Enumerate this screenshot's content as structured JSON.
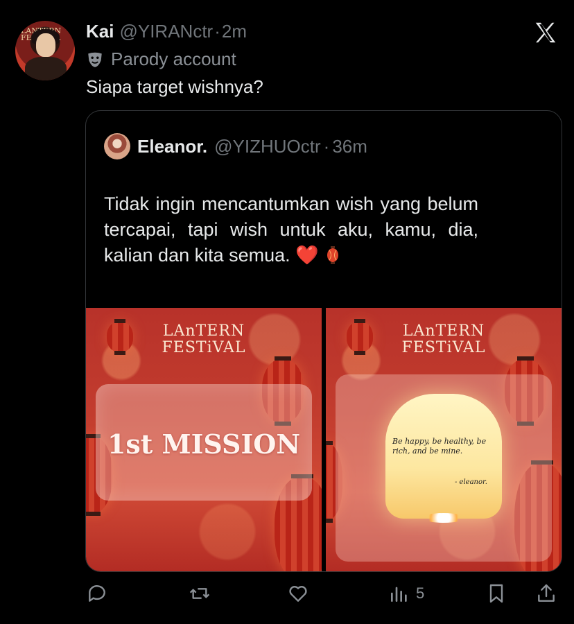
{
  "tweet": {
    "author_name": "Kai",
    "author_handle": "@YIRANctr",
    "separator": "·",
    "time": "2m",
    "badge_text": "Parody account",
    "text": "Siapa target wishnya?"
  },
  "avatar_text": "LANTERN\nFESTIVAL",
  "quote": {
    "author_name": "Eleanor.",
    "author_handle": "@YIZHUOctr",
    "separator": "·",
    "time": "36m",
    "text": "Tidak ingin  mencantumkan  wish yang belum  tercapai,  tapi  wish  untuk  aku, kamu, dia, kalian dan kita semua.",
    "heart_emoji": "❤️"
  },
  "media": {
    "left": {
      "festival_line1": "LAnTERN",
      "festival_line2": "FESTiVAL",
      "mission": "1st MISSION"
    },
    "right": {
      "festival_line1": "LAnTERN",
      "festival_line2": "FESTiVAL",
      "wish": "Be happy, be healthy, be rich, and be mine.",
      "signature": "- eleanor."
    }
  },
  "actions": {
    "views_count": "5",
    "icons": [
      "reply-icon",
      "retweet-icon",
      "like-icon",
      "views-icon",
      "bookmark-icon",
      "share-icon"
    ]
  },
  "colors": {
    "background": "#000000",
    "text": "#e7e9ea",
    "muted": "#71767b",
    "card_border": "#333639"
  }
}
